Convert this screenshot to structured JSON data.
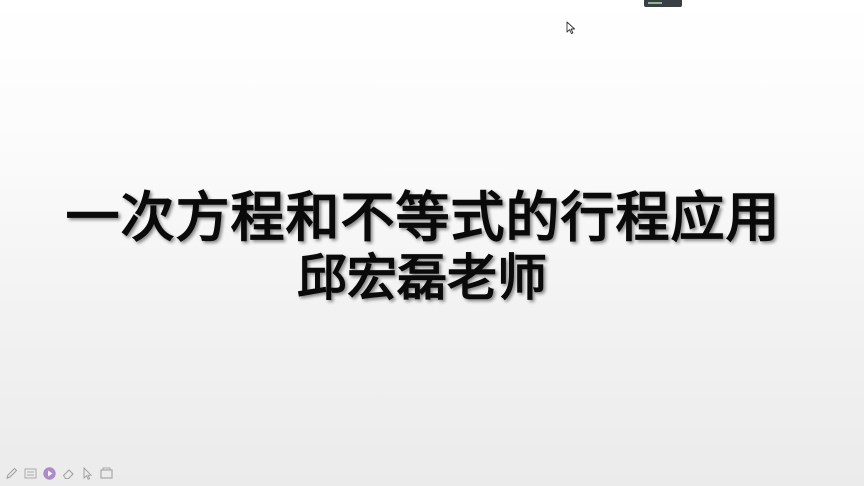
{
  "slide": {
    "title_line1": "一次方程和不等式的行程应用",
    "title_line2": "邱宏磊老师"
  },
  "toolbar": {
    "tools": [
      "pen-icon",
      "menu-icon",
      "pointer-play-icon",
      "eraser-icon",
      "arrow-cursor-icon",
      "screen-icon"
    ]
  },
  "colors": {
    "title_text": "#0a0a0a",
    "background_top": "#ffffff",
    "background_bottom": "#ebebeb",
    "accent_pointer": "#7b3fa8"
  }
}
